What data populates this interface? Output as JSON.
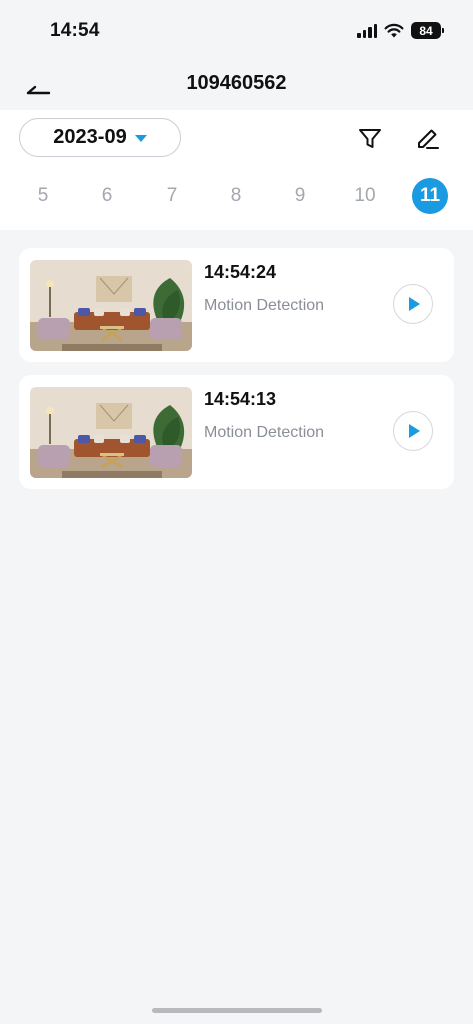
{
  "status": {
    "time": "14:54",
    "battery": "84"
  },
  "nav": {
    "title": "109460562",
    "back_icon": "back-arrow-icon"
  },
  "toolbar": {
    "month": "2023-09",
    "filter_icon": "filter-icon",
    "edit_icon": "edit-icon"
  },
  "days": [
    "5",
    "6",
    "7",
    "8",
    "9",
    "10",
    "11"
  ],
  "selected_day": "11",
  "events": [
    {
      "time": "14:54:24",
      "type": "Motion Detection"
    },
    {
      "time": "14:54:13",
      "type": "Motion Detection"
    }
  ],
  "colors": {
    "accent": "#1a9ae0",
    "background": "#f4f5f7",
    "card": "#ffffff"
  }
}
